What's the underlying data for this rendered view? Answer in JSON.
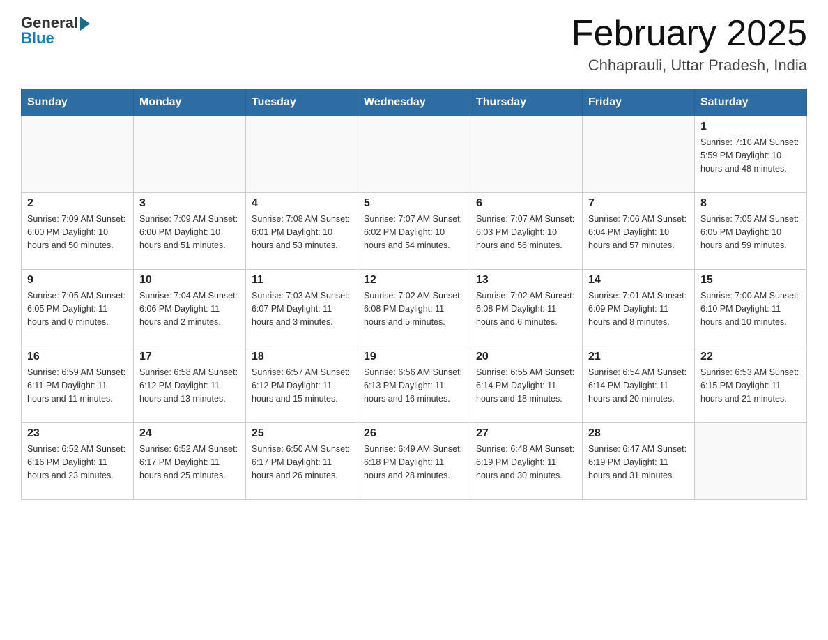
{
  "header": {
    "logo_general": "General",
    "logo_blue": "Blue",
    "title": "February 2025",
    "subtitle": "Chhaprauli, Uttar Pradesh, India"
  },
  "days_of_week": [
    "Sunday",
    "Monday",
    "Tuesday",
    "Wednesday",
    "Thursday",
    "Friday",
    "Saturday"
  ],
  "weeks": [
    {
      "days": [
        {
          "num": "",
          "info": ""
        },
        {
          "num": "",
          "info": ""
        },
        {
          "num": "",
          "info": ""
        },
        {
          "num": "",
          "info": ""
        },
        {
          "num": "",
          "info": ""
        },
        {
          "num": "",
          "info": ""
        },
        {
          "num": "1",
          "info": "Sunrise: 7:10 AM\nSunset: 5:59 PM\nDaylight: 10 hours and 48 minutes."
        }
      ]
    },
    {
      "days": [
        {
          "num": "2",
          "info": "Sunrise: 7:09 AM\nSunset: 6:00 PM\nDaylight: 10 hours and 50 minutes."
        },
        {
          "num": "3",
          "info": "Sunrise: 7:09 AM\nSunset: 6:00 PM\nDaylight: 10 hours and 51 minutes."
        },
        {
          "num": "4",
          "info": "Sunrise: 7:08 AM\nSunset: 6:01 PM\nDaylight: 10 hours and 53 minutes."
        },
        {
          "num": "5",
          "info": "Sunrise: 7:07 AM\nSunset: 6:02 PM\nDaylight: 10 hours and 54 minutes."
        },
        {
          "num": "6",
          "info": "Sunrise: 7:07 AM\nSunset: 6:03 PM\nDaylight: 10 hours and 56 minutes."
        },
        {
          "num": "7",
          "info": "Sunrise: 7:06 AM\nSunset: 6:04 PM\nDaylight: 10 hours and 57 minutes."
        },
        {
          "num": "8",
          "info": "Sunrise: 7:05 AM\nSunset: 6:05 PM\nDaylight: 10 hours and 59 minutes."
        }
      ]
    },
    {
      "days": [
        {
          "num": "9",
          "info": "Sunrise: 7:05 AM\nSunset: 6:05 PM\nDaylight: 11 hours and 0 minutes."
        },
        {
          "num": "10",
          "info": "Sunrise: 7:04 AM\nSunset: 6:06 PM\nDaylight: 11 hours and 2 minutes."
        },
        {
          "num": "11",
          "info": "Sunrise: 7:03 AM\nSunset: 6:07 PM\nDaylight: 11 hours and 3 minutes."
        },
        {
          "num": "12",
          "info": "Sunrise: 7:02 AM\nSunset: 6:08 PM\nDaylight: 11 hours and 5 minutes."
        },
        {
          "num": "13",
          "info": "Sunrise: 7:02 AM\nSunset: 6:08 PM\nDaylight: 11 hours and 6 minutes."
        },
        {
          "num": "14",
          "info": "Sunrise: 7:01 AM\nSunset: 6:09 PM\nDaylight: 11 hours and 8 minutes."
        },
        {
          "num": "15",
          "info": "Sunrise: 7:00 AM\nSunset: 6:10 PM\nDaylight: 11 hours and 10 minutes."
        }
      ]
    },
    {
      "days": [
        {
          "num": "16",
          "info": "Sunrise: 6:59 AM\nSunset: 6:11 PM\nDaylight: 11 hours and 11 minutes."
        },
        {
          "num": "17",
          "info": "Sunrise: 6:58 AM\nSunset: 6:12 PM\nDaylight: 11 hours and 13 minutes."
        },
        {
          "num": "18",
          "info": "Sunrise: 6:57 AM\nSunset: 6:12 PM\nDaylight: 11 hours and 15 minutes."
        },
        {
          "num": "19",
          "info": "Sunrise: 6:56 AM\nSunset: 6:13 PM\nDaylight: 11 hours and 16 minutes."
        },
        {
          "num": "20",
          "info": "Sunrise: 6:55 AM\nSunset: 6:14 PM\nDaylight: 11 hours and 18 minutes."
        },
        {
          "num": "21",
          "info": "Sunrise: 6:54 AM\nSunset: 6:14 PM\nDaylight: 11 hours and 20 minutes."
        },
        {
          "num": "22",
          "info": "Sunrise: 6:53 AM\nSunset: 6:15 PM\nDaylight: 11 hours and 21 minutes."
        }
      ]
    },
    {
      "days": [
        {
          "num": "23",
          "info": "Sunrise: 6:52 AM\nSunset: 6:16 PM\nDaylight: 11 hours and 23 minutes."
        },
        {
          "num": "24",
          "info": "Sunrise: 6:52 AM\nSunset: 6:17 PM\nDaylight: 11 hours and 25 minutes."
        },
        {
          "num": "25",
          "info": "Sunrise: 6:50 AM\nSunset: 6:17 PM\nDaylight: 11 hours and 26 minutes."
        },
        {
          "num": "26",
          "info": "Sunrise: 6:49 AM\nSunset: 6:18 PM\nDaylight: 11 hours and 28 minutes."
        },
        {
          "num": "27",
          "info": "Sunrise: 6:48 AM\nSunset: 6:19 PM\nDaylight: 11 hours and 30 minutes."
        },
        {
          "num": "28",
          "info": "Sunrise: 6:47 AM\nSunset: 6:19 PM\nDaylight: 11 hours and 31 minutes."
        },
        {
          "num": "",
          "info": ""
        }
      ]
    }
  ]
}
